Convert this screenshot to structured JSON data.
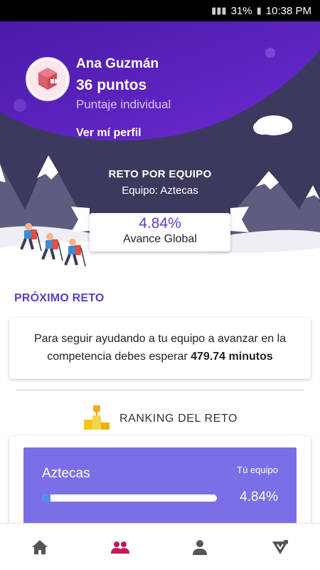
{
  "status_bar": {
    "battery": "31%",
    "time": "10:38 PM"
  },
  "user": {
    "name": "Ana Guzmán",
    "points": "36 puntos",
    "subtitle": "Puntaje individual",
    "profile_link": "Ver mí perfil"
  },
  "challenge": {
    "title": "RETO POR EQUIPO",
    "team": "Equipo: Aztecas",
    "progress_value": "4.84%",
    "progress_label": "Avance Global"
  },
  "next_challenge": {
    "title": "PRÓXIMO RETO",
    "message": "Para seguir ayudando a tu equipo a avanzar en la competencia debes esperar",
    "wait_time": "479.74 minutos"
  },
  "ranking": {
    "title": "RANKING DEL RETO",
    "items": [
      {
        "team": "Aztecas",
        "tag": "Tú equipo",
        "percent": "4.84%",
        "progress": 0.0484
      }
    ]
  },
  "colors": {
    "purple": "#5b23c8",
    "accent": "#5b3fc4",
    "rank_bg": "#7b6fe8",
    "nav_active": "#c2185b"
  },
  "nav": [
    {
      "icon": "home-icon"
    },
    {
      "icon": "team-icon"
    },
    {
      "icon": "person-icon"
    },
    {
      "icon": "mountain-flag-icon"
    }
  ]
}
